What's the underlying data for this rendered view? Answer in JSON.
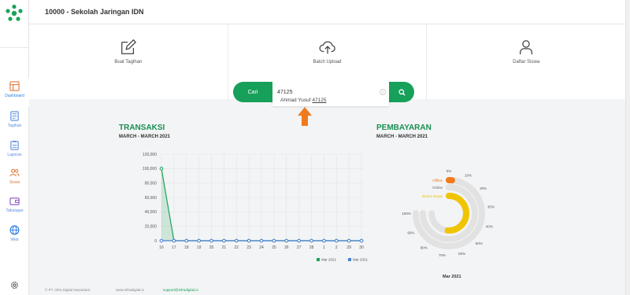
{
  "header": {
    "title": "10000 - Sekolah Jaringan IDN"
  },
  "sidebar": {
    "items": [
      {
        "label": "Dashboard",
        "icon": "dashboard-icon"
      },
      {
        "label": "Tagihan",
        "icon": "invoice-icon"
      },
      {
        "label": "Laporan",
        "icon": "report-icon"
      },
      {
        "label": "Siswa",
        "icon": "users-icon"
      },
      {
        "label": "Tabungan",
        "icon": "wallet-icon"
      },
      {
        "label": "Web",
        "icon": "globe-icon"
      }
    ]
  },
  "cards": [
    {
      "label": "Buat Tagihan",
      "icon": "edit-icon"
    },
    {
      "label": "Batch Upload",
      "icon": "cloud-upload-icon"
    },
    {
      "label": "Daftar Siswa",
      "icon": "user-icon"
    }
  ],
  "search": {
    "button_label": "Cari",
    "value": "47125",
    "suggestion_name": "Ahmad Yusuf",
    "suggestion_id": "47125"
  },
  "transaksi": {
    "title": "TRANSAKSI",
    "subtitle": "MARCH - MARCH 2021"
  },
  "pembayaran": {
    "title": "PEMBAYARAN",
    "subtitle": "MARCH - MARCH 2021",
    "caption": "Mar 2021"
  },
  "chart_data": [
    {
      "type": "area",
      "title": "TRANSAKSI",
      "subtitle": "MARCH - MARCH 2021",
      "categories": [
        "16",
        "17",
        "18",
        "19",
        "20",
        "21",
        "22",
        "23",
        "24",
        "25",
        "26",
        "27",
        "28",
        "1",
        "2",
        "29",
        "30"
      ],
      "yticks": [
        "0",
        "20,000",
        "40,000",
        "60,000",
        "80,000",
        "100,000",
        "120,000"
      ],
      "ylim": [
        0,
        120000
      ],
      "grid": true,
      "legend_position": "bottom-right",
      "series": [
        {
          "name": "Mar 2021",
          "color": "#1aa35a",
          "values": [
            100000,
            0,
            0,
            0,
            0,
            0,
            0,
            0,
            0,
            0,
            0,
            0,
            0,
            0,
            0,
            0,
            0
          ]
        },
        {
          "name": "Mar 2021",
          "color": "#4a7fd6",
          "values": [
            0,
            0,
            0,
            0,
            0,
            0,
            0,
            0,
            0,
            0,
            0,
            0,
            0,
            0,
            0,
            0,
            0
          ]
        }
      ]
    },
    {
      "type": "pie",
      "subtype": "radial-bar",
      "title": "PEMBAYARAN",
      "subtitle": "MARCH - MARCH 2021",
      "caption": "Mar 2021",
      "scale_labels": [
        "0%",
        "10%",
        "20%",
        "30%",
        "40%",
        "50%",
        "60%",
        "70%",
        "80%",
        "90%",
        "100%"
      ],
      "series": [
        {
          "name": "Offline",
          "value": 2,
          "color": "#f07b1e"
        },
        {
          "name": "Online",
          "value": 0,
          "color": "#c8c8c8"
        },
        {
          "name": "Belum Bayar",
          "value": 68,
          "color": "#f0c400"
        }
      ]
    }
  ]
}
